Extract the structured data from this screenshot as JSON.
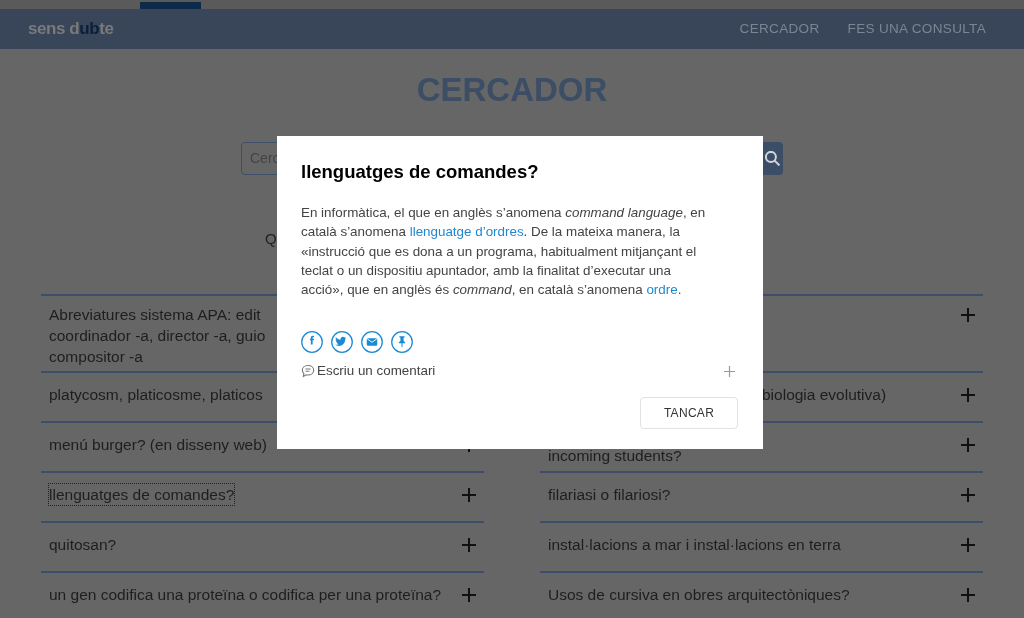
{
  "logo": [
    {
      "text": "sens d",
      "highlight": false
    },
    {
      "text": "ub",
      "highlight": true
    },
    {
      "text": "te",
      "highlight": false
    }
  ],
  "nav": [
    "CERCADOR",
    "FES UNA CONSULTA"
  ],
  "title": "CERCADOR",
  "search": {
    "placeholder": "Cerc"
  },
  "subtitle": "Q",
  "columns": [
    [
      {
        "text": "Abreviatures sistema APA: edit\ncoordinador -a, director -a, guio\ncompositor -a",
        "kind": "plain",
        "focused": false
      },
      {
        "text": "platycosm, platicosme, platicos",
        "kind": "plain",
        "focused": false
      },
      {
        "text": "menú burger? (en disseny web)",
        "kind": "plain",
        "focused": false
      },
      {
        "text": "llenguatges de comandes?",
        "kind": "plain",
        "focused": true
      },
      {
        "text": "quitosan?",
        "kind": "plain",
        "focused": false
      },
      {
        "text": "un gen codifica una proteïna o codifica per una proteïna?",
        "kind": "plain",
        "focused": false
      }
    ],
    [
      {
        "kind": "hidden",
        "focused": false
      },
      {
        "text": "biologia evolutiva)",
        "kind": "partly_hidden",
        "focused": false
      },
      {
        "text": "incoming students?",
        "kind": "partly_covered_top",
        "focused": false
      },
      {
        "text": "filariasi o filariosi?",
        "kind": "plain",
        "focused": false
      },
      {
        "text": "instal·lacions a mar i instal·lacions en terra",
        "kind": "plain",
        "focused": false
      },
      {
        "text": "Usos de cursiva en obres arquitectòniques?",
        "kind": "plain",
        "focused": false
      }
    ]
  ],
  "dialog": {
    "title": "llenguatges de comandes?",
    "body": [
      {
        "kind": "text",
        "text": "En informàtica, el que en anglès s’anomena *command language*, en català s’anomena "
      },
      {
        "kind": "link",
        "text": "llenguatge d’ordres"
      },
      {
        "kind": "text",
        "text": ". De la mateixa manera, la «instrucció que es dona a un programa, habitualment mitjançant el teclat o un dispositiu apuntador, amb la finalitat d’executar una acció», que en anglès és *command*, en català s’anomena "
      },
      {
        "kind": "link",
        "text": "ordre"
      },
      {
        "kind": "text",
        "text": "."
      }
    ],
    "comment": "Escriu un comentari",
    "button": "TANCAR"
  }
}
